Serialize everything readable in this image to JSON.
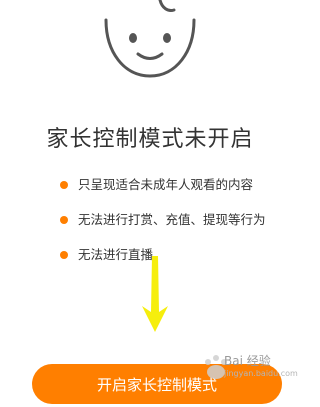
{
  "title": "家长控制模式未开启",
  "features": [
    {
      "label": "只呈现适合未成年人观看的内容"
    },
    {
      "label": "无法进行打赏、充值、提现等行为"
    },
    {
      "label": "无法进行直播"
    }
  ],
  "enable_button": {
    "label": "开启家长控制模式"
  },
  "watermark": {
    "text": "Bai 经验",
    "sub": "jingyan.baidu.com"
  },
  "colors": {
    "accent": "#FF7F00",
    "arrow": "#F6EE0D",
    "title_text": "#333333",
    "icon_stroke": "#555555"
  },
  "icons": {
    "face": "baby-face-icon",
    "bullet": "bullet-dot-icon",
    "arrow": "arrow-down-icon"
  }
}
